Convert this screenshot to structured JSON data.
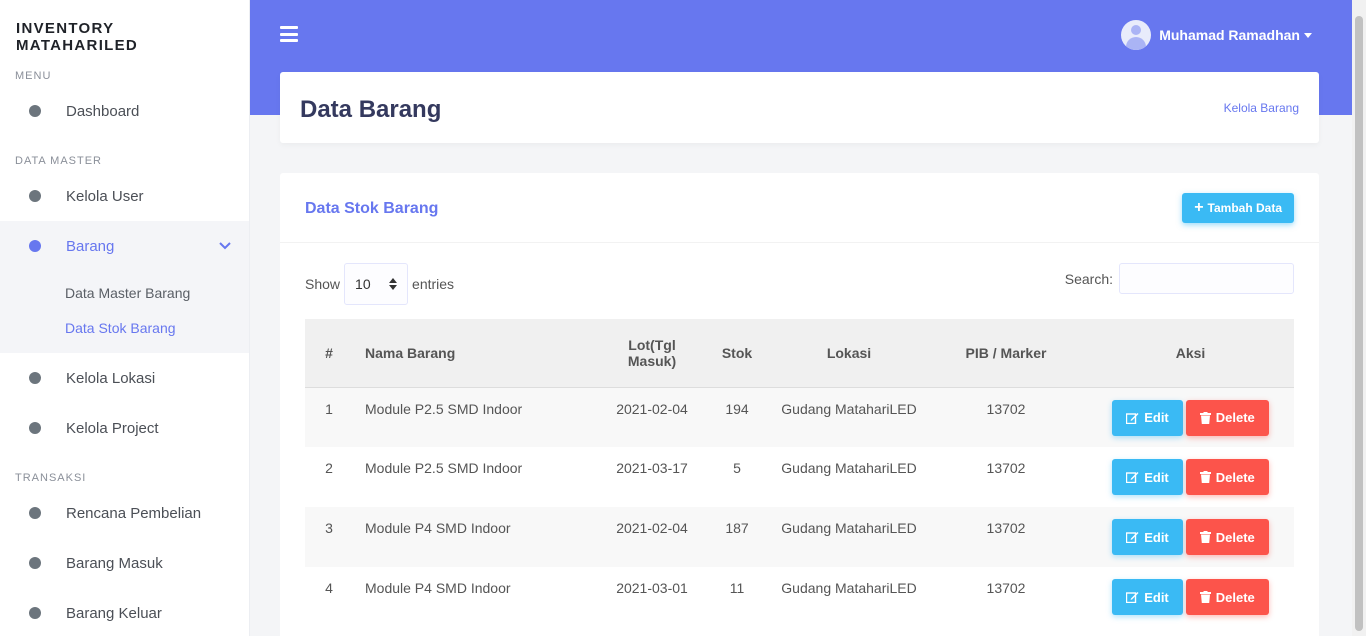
{
  "brand": "INVENTORY MATAHARILED",
  "sidebar": {
    "sections": [
      {
        "label": "MENU"
      },
      {
        "label": "DATA MASTER"
      },
      {
        "label": "TRANSAKSI"
      }
    ],
    "items": [
      {
        "label": "Dashboard"
      },
      {
        "label": "Kelola User"
      },
      {
        "label": "Barang"
      },
      {
        "label": "Kelola Lokasi"
      },
      {
        "label": "Kelola Project"
      },
      {
        "label": "Rencana Pembelian"
      },
      {
        "label": "Barang Masuk"
      },
      {
        "label": "Barang Keluar"
      }
    ],
    "submenu": [
      {
        "label": "Data Master Barang"
      },
      {
        "label": "Data Stok Barang"
      }
    ]
  },
  "header": {
    "user_name": "Muhamad Ramadhan"
  },
  "page": {
    "title": "Data Barang",
    "breadcrumb": "Kelola Barang"
  },
  "card": {
    "title": "Data Stok Barang",
    "add_button": "Tambah Data",
    "show_label": "Show",
    "entries_value": "10",
    "entries_label": "entries",
    "search_label": "Search:"
  },
  "table": {
    "columns": [
      "#",
      "Nama Barang",
      "Lot(Tgl Masuk)",
      "Stok",
      "Lokasi",
      "PIB / Marker",
      "Aksi"
    ],
    "edit_label": "Edit",
    "delete_label": "Delete",
    "rows": [
      {
        "no": "1",
        "nama": "Module P2.5 SMD Indoor",
        "lot": "2021-02-04",
        "stok": "194",
        "lokasi": "Gudang MatahariLED",
        "pib": "13702"
      },
      {
        "no": "2",
        "nama": "Module P2.5 SMD Indoor",
        "lot": "2021-03-17",
        "stok": "5",
        "lokasi": "Gudang MatahariLED",
        "pib": "13702"
      },
      {
        "no": "3",
        "nama": "Module P4 SMD Indoor",
        "lot": "2021-02-04",
        "stok": "187",
        "lokasi": "Gudang MatahariLED",
        "pib": "13702"
      },
      {
        "no": "4",
        "nama": "Module P4 SMD Indoor",
        "lot": "2021-03-01",
        "stok": "11",
        "lokasi": "Gudang MatahariLED",
        "pib": "13702"
      }
    ]
  },
  "colors": {
    "primary": "#6777ef",
    "info": "#3abaf4",
    "danger": "#fc544b"
  }
}
